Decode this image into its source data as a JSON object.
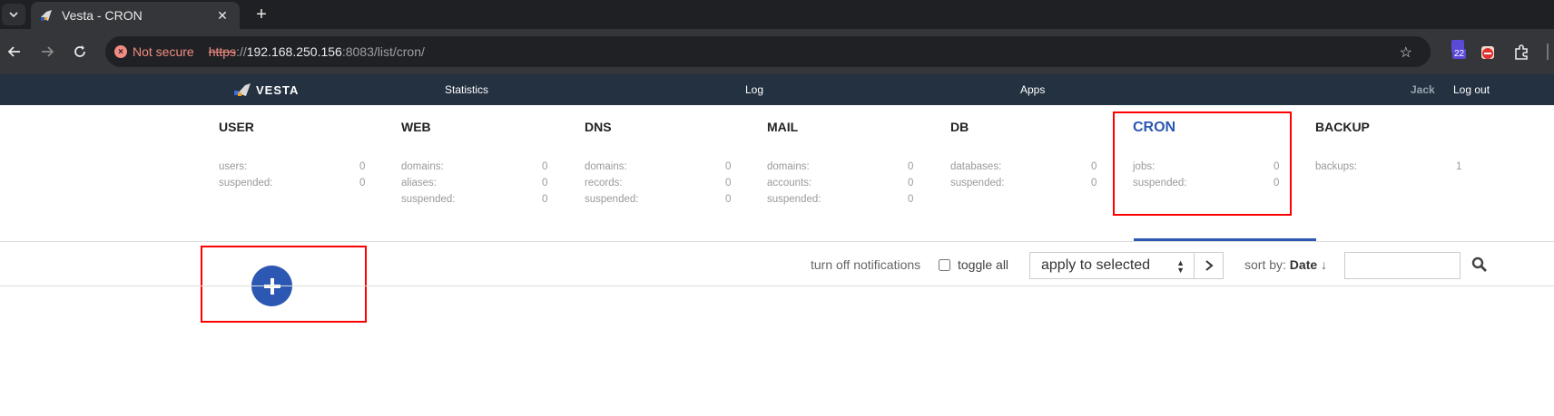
{
  "browser": {
    "tab_title": "Vesta - CRON",
    "close_glyph": "✕",
    "new_tab_glyph": "+",
    "not_secure_label": "Not secure",
    "url_scheme": "https",
    "url_sep": "://",
    "url_host": "192.168.250.156",
    "url_path": ":8083/list/cron/",
    "extension_badge": "22"
  },
  "vesta_nav": {
    "logo_text": "VESTA",
    "links": [
      "Statistics",
      "Log",
      "Apps"
    ],
    "user": "Jack",
    "logout": "Log out"
  },
  "stats": [
    {
      "title": "USER",
      "rows": [
        [
          "users:",
          "0"
        ],
        [
          "suspended:",
          "0"
        ]
      ]
    },
    {
      "title": "WEB",
      "rows": [
        [
          "domains:",
          "0"
        ],
        [
          "aliases:",
          "0"
        ],
        [
          "suspended:",
          "0"
        ]
      ]
    },
    {
      "title": "DNS",
      "rows": [
        [
          "domains:",
          "0"
        ],
        [
          "records:",
          "0"
        ],
        [
          "suspended:",
          "0"
        ]
      ]
    },
    {
      "title": "MAIL",
      "rows": [
        [
          "domains:",
          "0"
        ],
        [
          "accounts:",
          "0"
        ],
        [
          "suspended:",
          "0"
        ]
      ]
    },
    {
      "title": "DB",
      "rows": [
        [
          "databases:",
          "0"
        ],
        [
          "suspended:",
          "0"
        ]
      ]
    },
    {
      "title": "CRON",
      "rows": [
        [
          "jobs:",
          "0"
        ],
        [
          "suspended:",
          "0"
        ]
      ]
    },
    {
      "title": "BACKUP",
      "rows": [
        [
          "backups:",
          "1"
        ]
      ]
    }
  ],
  "actions": {
    "turn_off_notifications": "turn off notifications",
    "toggle_all": "toggle all",
    "apply_selected": "apply to selected",
    "sort_by_label": "sort by:",
    "sort_by_value": "Date",
    "sort_arrow": "↓",
    "search_value": ""
  },
  "colors": {
    "nav_bg": "#233140",
    "accent": "#2c57b3",
    "highlight_box": "#ff0000"
  }
}
